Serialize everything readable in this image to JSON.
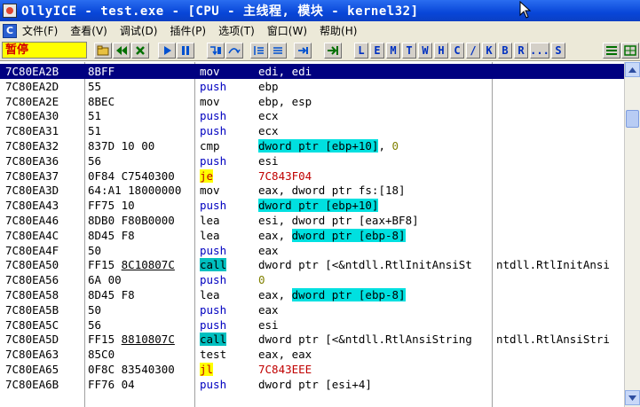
{
  "window": {
    "title": "OllyICE - test.exe - [CPU -  主线程, 模块 - kernel32]"
  },
  "menu": {
    "items": [
      {
        "label": "文件(F)"
      },
      {
        "label": "查看(V)"
      },
      {
        "label": "调试(D)"
      },
      {
        "label": "插件(P)"
      },
      {
        "label": "选项(T)"
      },
      {
        "label": "窗口(W)"
      },
      {
        "label": "帮助(H)"
      }
    ]
  },
  "toolbar": {
    "status": "暂停",
    "letters": [
      "L",
      "E",
      "M",
      "T",
      "W",
      "H",
      "C",
      "/",
      "K",
      "B",
      "R",
      "...",
      "S"
    ]
  },
  "disasm": {
    "rows": [
      {
        "addr": "7C80EA2B",
        "hex": "8BFF",
        "mnem": "mov",
        "operand": "edi, edi",
        "comment": ""
      },
      {
        "addr": "7C80EA2D",
        "hex": "55",
        "mnem": "push",
        "operand": "ebp",
        "comment": ""
      },
      {
        "addr": "7C80EA2E",
        "hex": "8BEC",
        "mnem": "mov",
        "operand": "ebp, esp",
        "comment": ""
      },
      {
        "addr": "7C80EA30",
        "hex": "51",
        "mnem": "push",
        "operand": "ecx",
        "comment": ""
      },
      {
        "addr": "7C80EA31",
        "hex": "51",
        "mnem": "push",
        "operand": "ecx",
        "comment": ""
      },
      {
        "addr": "7C80EA32",
        "hex": "837D 10 00",
        "mnem": "cmp",
        "operand_hl": "dword ptr [ebp+10]",
        "operand_rest": ", ",
        "operand_num": "0",
        "comment": ""
      },
      {
        "addr": "7C80EA36",
        "hex": "56",
        "mnem": "push",
        "operand": "esi",
        "comment": ""
      },
      {
        "addr": "7C80EA37",
        "hex": "0F84 C7540300",
        "mnem": "je",
        "operand": "7C843F04",
        "comment": ""
      },
      {
        "addr": "7C80EA3D",
        "hex": "64:A1 18000000",
        "mnem": "mov",
        "operand": "eax, dword ptr fs:[18]",
        "comment": ""
      },
      {
        "addr": "7C80EA43",
        "hex": "FF75 10",
        "mnem": "push",
        "operand_hl": "dword ptr [ebp+10]",
        "comment": ""
      },
      {
        "addr": "7C80EA46",
        "hex": "8DB0 F80B0000",
        "mnem": "lea",
        "operand": "esi, dword ptr [eax+BF8]",
        "comment": ""
      },
      {
        "addr": "7C80EA4C",
        "hex": "8D45 F8",
        "mnem": "lea",
        "operand_pre": "eax, ",
        "operand_hl": "dword ptr [ebp-8]",
        "comment": ""
      },
      {
        "addr": "7C80EA4F",
        "hex": "50",
        "mnem": "push",
        "operand": "eax",
        "comment": ""
      },
      {
        "addr": "7C80EA50",
        "hex_pre": "FF15 ",
        "hex_ul": "8C10807C",
        "mnem": "call",
        "operand": "dword ptr [<&ntdll.RtlInitAnsiSt",
        "comment": "ntdll.RtlInitAnsi"
      },
      {
        "addr": "7C80EA56",
        "hex": "6A 00",
        "mnem": "push",
        "operand_num": "0",
        "comment": ""
      },
      {
        "addr": "7C80EA58",
        "hex": "8D45 F8",
        "mnem": "lea",
        "operand_pre": "eax, ",
        "operand_hl": "dword ptr [ebp-8]",
        "comment": ""
      },
      {
        "addr": "7C80EA5B",
        "hex": "50",
        "mnem": "push",
        "operand": "eax",
        "comment": ""
      },
      {
        "addr": "7C80EA5C",
        "hex": "56",
        "mnem": "push",
        "operand": "esi",
        "comment": ""
      },
      {
        "addr": "7C80EA5D",
        "hex_pre": "FF15 ",
        "hex_ul": "8810807C",
        "mnem": "call",
        "operand": "dword ptr [<&ntdll.RtlAnsiString",
        "comment": "ntdll.RtlAnsiStri"
      },
      {
        "addr": "7C80EA63",
        "hex": "85C0",
        "mnem": "test",
        "operand": "eax, eax",
        "comment": ""
      },
      {
        "addr": "7C80EA65",
        "hex": "0F8C 83540300",
        "mnem": "jl",
        "operand": "7C843EEE",
        "comment": ""
      },
      {
        "addr": "7C80EA6B",
        "hex": "FF76 04",
        "mnem": "push",
        "operand": "dword ptr [esi+4]",
        "comment": ""
      }
    ]
  }
}
